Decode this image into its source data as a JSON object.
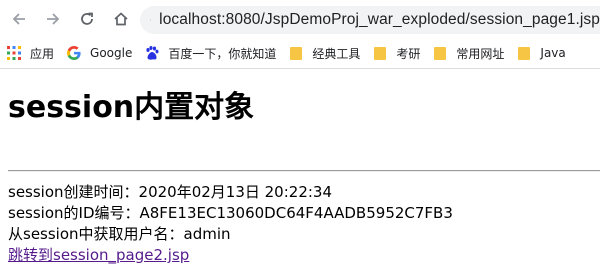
{
  "browser": {
    "url": "localhost:8080/JspDemoProj_war_exploded/session_page1.jsp",
    "icons": [
      "back-icon",
      "forward-icon",
      "reload-icon",
      "home-icon",
      "info-icon"
    ]
  },
  "bookmarks": [
    {
      "label": "应用",
      "icon": "apps-grid-icon"
    },
    {
      "label": "Google",
      "icon": "google-icon"
    },
    {
      "label": "百度一下，你就知道",
      "icon": "baidu-paw-icon"
    },
    {
      "label": "经典工具",
      "icon": "folder-icon"
    },
    {
      "label": "考研",
      "icon": "folder-icon"
    },
    {
      "label": "常用网址",
      "icon": "folder-icon"
    },
    {
      "label": "Java",
      "icon": "folder-icon"
    }
  ],
  "page": {
    "heading": "session内置对象",
    "line1": "session创建时间：2020年02月13日 20:22:34",
    "line2": "session的ID编号：A8FE13EC13060DC64F4AADB5952C7FB3",
    "line3": "从session中获取用户名：admin",
    "link": "跳转到session_page2.jsp",
    "link_color": "#551a8b"
  }
}
